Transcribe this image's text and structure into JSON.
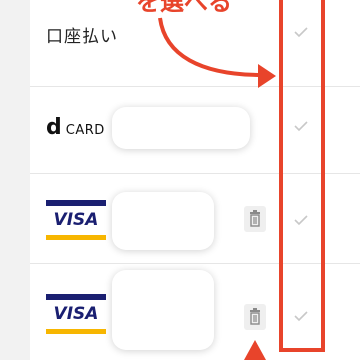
{
  "annotation": {
    "callout_text": "を選べる",
    "color": "#e8442b"
  },
  "rows": [
    {
      "type": "text-method",
      "label": "口座払い"
    },
    {
      "type": "brand-logo",
      "brand_d": "d",
      "brand_rest": "CARD"
    },
    {
      "type": "card",
      "brand": "VISA"
    },
    {
      "type": "card",
      "brand": "VISA"
    }
  ],
  "icons": {
    "delete": "trash-icon",
    "select": "checkmark-icon"
  }
}
